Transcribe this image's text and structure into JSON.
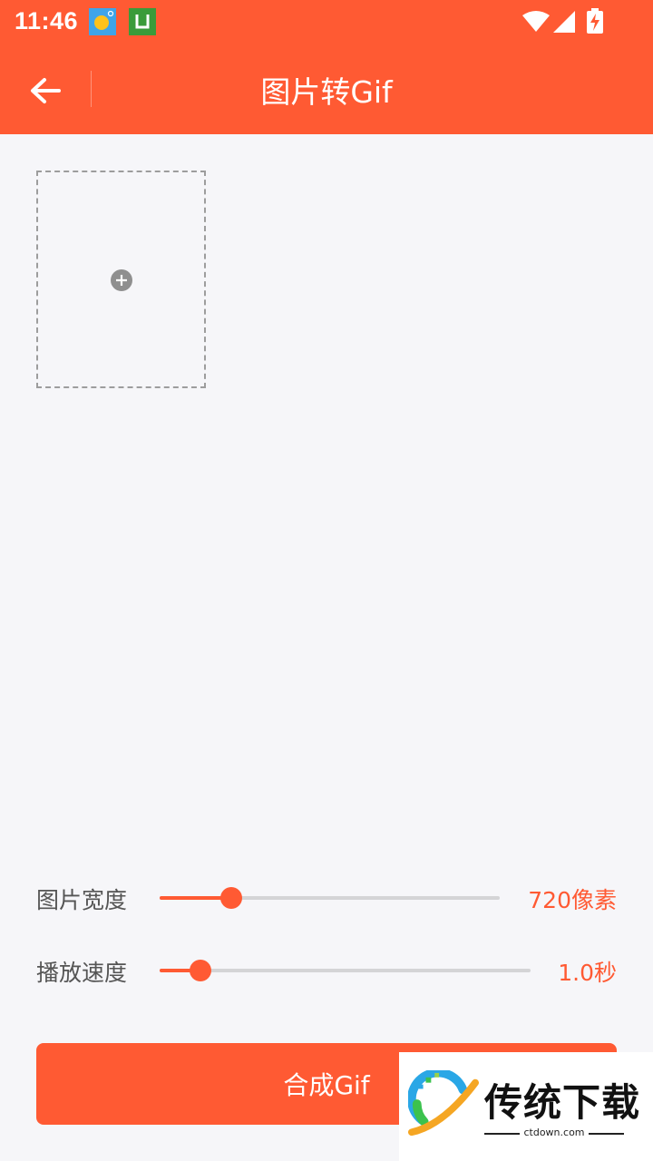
{
  "status_bar": {
    "time": "11:46",
    "icons": [
      "weather-icon",
      "store-icon",
      "wifi-icon",
      "signal-icon",
      "battery-charging-icon"
    ]
  },
  "app_bar": {
    "title": "图片转Gif",
    "back_icon": "arrow-left-icon"
  },
  "image_slot": {
    "icon": "plus-circle-icon"
  },
  "settings": {
    "width": {
      "label": "图片宽度",
      "value": "720像素",
      "fraction": 0.21
    },
    "speed": {
      "label": "播放速度",
      "value": "1.0秒",
      "fraction": 0.11
    }
  },
  "compose_button": {
    "label": "合成Gif"
  },
  "watermark": {
    "text": "传统下载",
    "domain": "ctdown.com"
  },
  "colors": {
    "accent": "#ff5a33",
    "background": "#f6f6f9",
    "track": "#d4d4d6",
    "label": "#555555"
  }
}
